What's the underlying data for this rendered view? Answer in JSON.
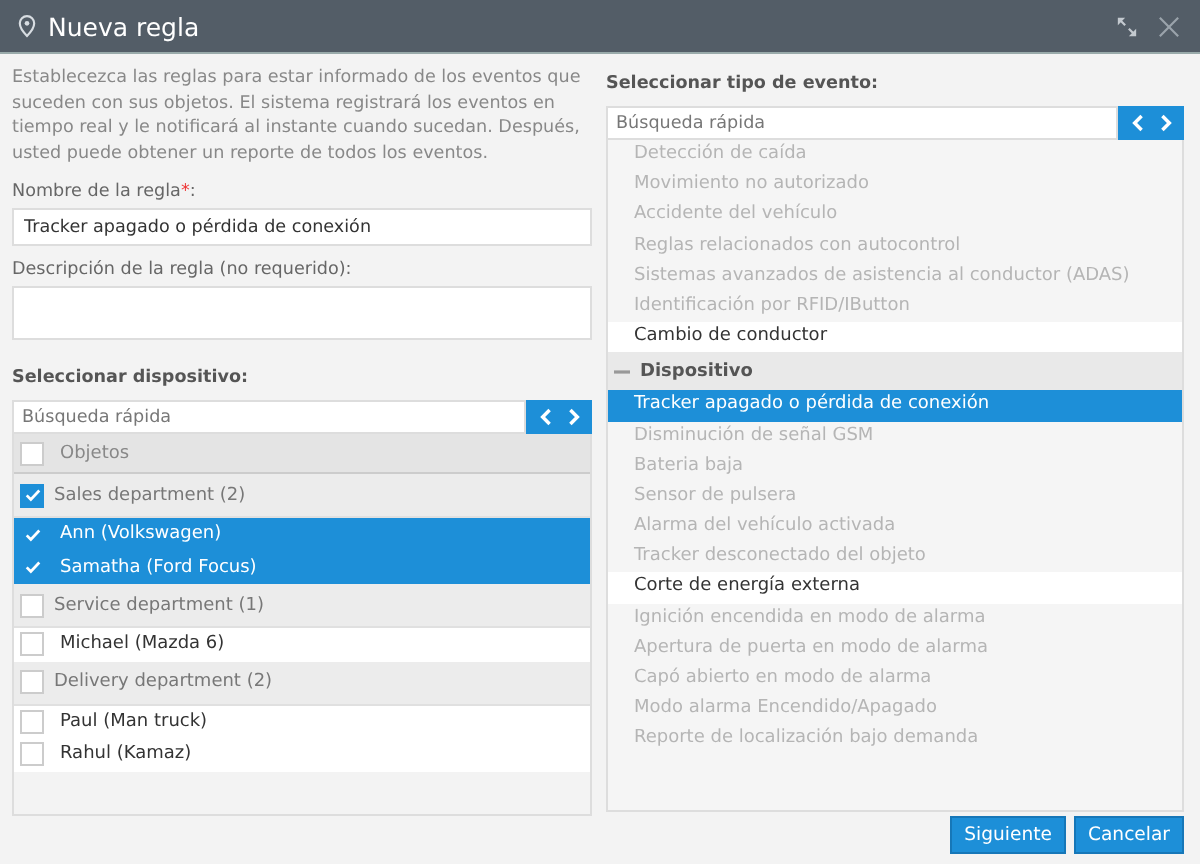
{
  "window": {
    "title": "Nueva regla"
  },
  "intro": "Establecezca las reglas para estar informado de los eventos que suceden con sus objetos. El sistema registrará los eventos en tiempo real y le notificará al instante cuando sucedan. Después, usted puede obtener un reporte de todos los eventos.",
  "rule_name": {
    "label": "Nombre de la regla",
    "required_mark": "*",
    "label_suffix": ":",
    "value": "Tracker apagado o pérdida de conexión"
  },
  "rule_description": {
    "label": "Descripción de la regla (no requerido):"
  },
  "devices": {
    "title": "Seleccionar dispositivo:",
    "search": {
      "placeholder": "Búsqueda rápida"
    },
    "header": {
      "label": "Objetos",
      "checked": false
    },
    "groups": [
      {
        "label": "Sales department (2)",
        "checked": true,
        "children": [
          {
            "label": "Ann (Volkswagen)",
            "checked": true,
            "selected": true
          },
          {
            "label": "Samatha (Ford Focus)",
            "checked": true,
            "selected": true
          }
        ]
      },
      {
        "label": "Service department (1)",
        "checked": false,
        "children": [
          {
            "label": "Michael (Mazda 6)",
            "checked": false,
            "selected": false
          }
        ]
      },
      {
        "label": "Delivery department (2)",
        "checked": false,
        "children": [
          {
            "label": "Paul (Man truck)",
            "checked": false,
            "selected": false
          },
          {
            "label": "Rahul (Kamaz)",
            "checked": false,
            "selected": false
          }
        ]
      }
    ]
  },
  "events": {
    "title": "Seleccionar tipo de evento:",
    "search": {
      "placeholder": "Búsqueda rápida"
    },
    "items": [
      {
        "kind": "event",
        "label": "Detección de caída",
        "disabled": true,
        "selected": false
      },
      {
        "kind": "event",
        "label": "Movimiento no autorizado",
        "disabled": true,
        "selected": false
      },
      {
        "kind": "event",
        "label": "Accidente del vehículo",
        "disabled": true,
        "selected": false
      },
      {
        "kind": "event",
        "label": "Reglas relacionados con autocontrol",
        "disabled": true,
        "selected": false
      },
      {
        "kind": "event",
        "label": "Sistemas avanzados de asistencia al conductor (ADAS)",
        "disabled": true,
        "selected": false
      },
      {
        "kind": "event",
        "label": "Identificación por RFID/IButton",
        "disabled": true,
        "selected": false
      },
      {
        "kind": "event",
        "label": "Cambio de conductor",
        "disabled": false,
        "selected": false
      },
      {
        "kind": "group",
        "label": "Dispositivo",
        "expanded": true
      },
      {
        "kind": "event",
        "label": "Tracker apagado o pérdida de conexión",
        "disabled": false,
        "selected": true
      },
      {
        "kind": "event",
        "label": "Disminución de señal GSM",
        "disabled": true,
        "selected": false
      },
      {
        "kind": "event",
        "label": "Bateria baja",
        "disabled": true,
        "selected": false
      },
      {
        "kind": "event",
        "label": "Sensor de pulsera",
        "disabled": true,
        "selected": false
      },
      {
        "kind": "event",
        "label": "Alarma del vehículo activada",
        "disabled": true,
        "selected": false
      },
      {
        "kind": "event",
        "label": "Tracker desconectado del objeto",
        "disabled": true,
        "selected": false
      },
      {
        "kind": "event",
        "label": "Corte de energía externa",
        "disabled": false,
        "selected": false
      },
      {
        "kind": "event",
        "label": "Ignición encendida en modo de alarma",
        "disabled": true,
        "selected": false
      },
      {
        "kind": "event",
        "label": "Apertura de puerta en modo de alarma",
        "disabled": true,
        "selected": false
      },
      {
        "kind": "event",
        "label": "Capó abierto en modo de alarma",
        "disabled": true,
        "selected": false
      },
      {
        "kind": "event",
        "label": "Modo alarma Encendido/Apagado",
        "disabled": true,
        "selected": false
      },
      {
        "kind": "event",
        "label": "Reporte de localización bajo demanda",
        "disabled": true,
        "selected": false
      }
    ]
  },
  "buttons": [
    {
      "label": "Siguiente"
    },
    {
      "label": "Cancelar"
    }
  ]
}
